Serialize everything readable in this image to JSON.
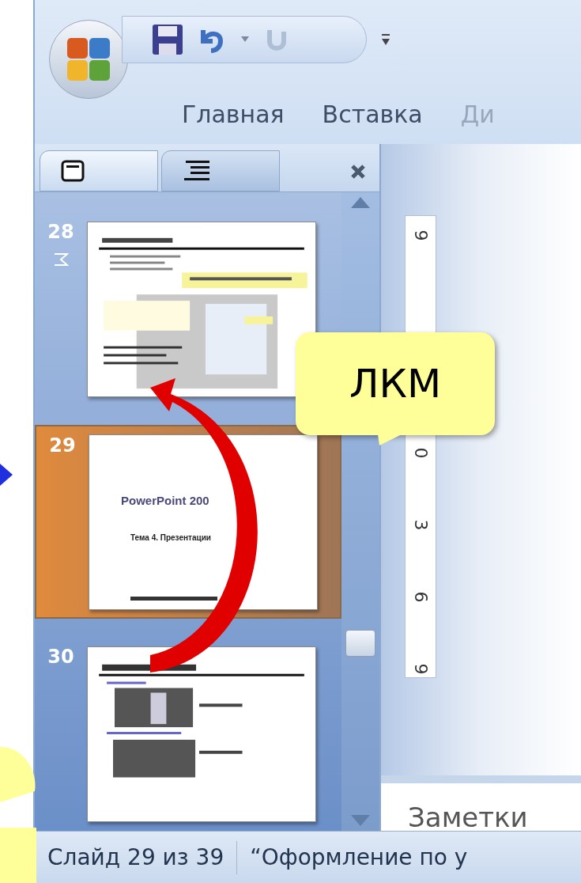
{
  "ribbon_tabs": [
    {
      "label": "Главная",
      "faded": false
    },
    {
      "label": "Вставка",
      "faded": false
    },
    {
      "label": "Ди",
      "faded": true
    }
  ],
  "pane_tabs": [
    {
      "kind": "slides",
      "selected": true
    },
    {
      "kind": "outline",
      "selected": false
    }
  ],
  "slides": [
    {
      "number": "28",
      "selected": false,
      "kind": "table"
    },
    {
      "number": "29",
      "selected": true,
      "kind": "title",
      "title": "PowerPoint 200",
      "subtitle": "Тема 4. Презентации"
    },
    {
      "number": "30",
      "selected": false,
      "kind": "images"
    }
  ],
  "ruler": {
    "labels": [
      "9",
      "0",
      "3",
      "6",
      "9"
    ]
  },
  "callout": {
    "text": "ЛКМ"
  },
  "notes": {
    "placeholder": "Заметки"
  },
  "status_bar": {
    "slide": "Слайд 29 из 39",
    "theme": "“Оформление по у"
  }
}
